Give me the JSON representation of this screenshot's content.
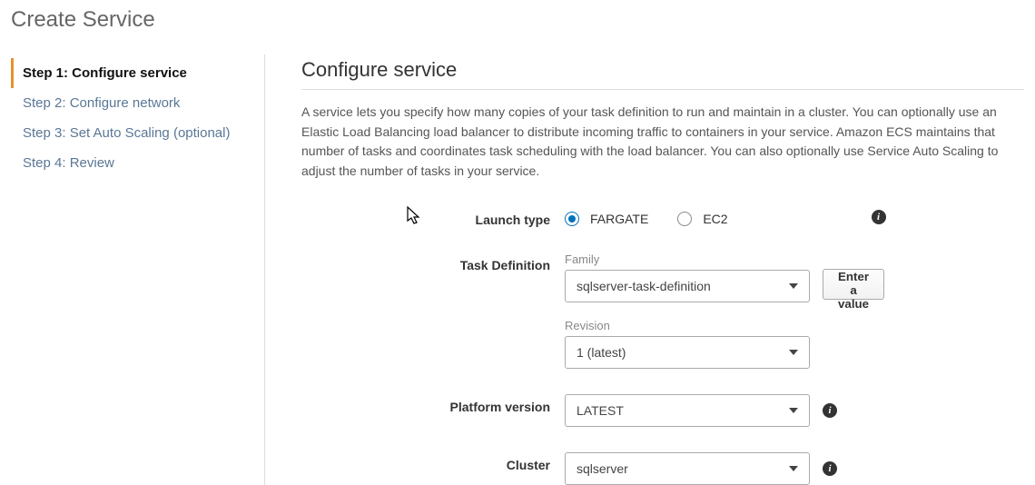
{
  "page_title": "Create Service",
  "steps": [
    {
      "label": "Step 1: Configure service",
      "active": true
    },
    {
      "label": "Step 2: Configure network",
      "active": false
    },
    {
      "label": "Step 3: Set Auto Scaling (optional)",
      "active": false
    },
    {
      "label": "Step 4: Review",
      "active": false
    }
  ],
  "section": {
    "title": "Configure service",
    "description": "A service lets you specify how many copies of your task definition to run and maintain in a cluster. You can optionally use an Elastic Load Balancing load balancer to distribute incoming traffic to containers in your service. Amazon ECS maintains that number of tasks and coordinates task scheduling with the load balancer. You can also optionally use Service Auto Scaling to adjust the number of tasks in your service."
  },
  "form": {
    "launch_type": {
      "label": "Launch type",
      "options": [
        {
          "value": "FARGATE",
          "selected": true
        },
        {
          "value": "EC2",
          "selected": false
        }
      ]
    },
    "task_definition": {
      "label": "Task Definition",
      "family_label": "Family",
      "family_value": "sqlserver-task-definition",
      "revision_label": "Revision",
      "revision_value": "1 (latest)",
      "enter_value_label": "Enter a value"
    },
    "platform_version": {
      "label": "Platform version",
      "value": "LATEST"
    },
    "cluster": {
      "label": "Cluster",
      "value": "sqlserver"
    }
  }
}
